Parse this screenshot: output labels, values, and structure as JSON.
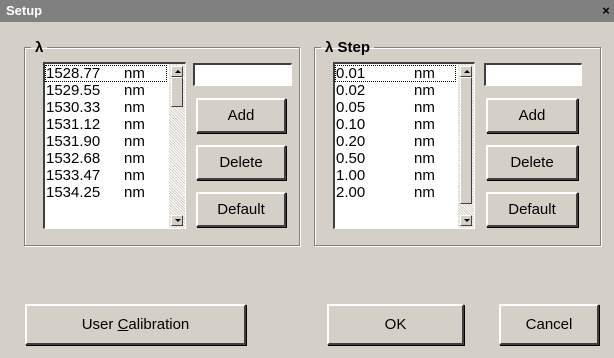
{
  "window": {
    "title": "Setup",
    "close_glyph": "×"
  },
  "lambda_group": {
    "legend": "λ",
    "list": [
      {
        "value": "1528.77",
        "unit": "nm"
      },
      {
        "value": "1529.55",
        "unit": "nm"
      },
      {
        "value": "1530.33",
        "unit": "nm"
      },
      {
        "value": "1531.12",
        "unit": "nm"
      },
      {
        "value": "1531.90",
        "unit": "nm"
      },
      {
        "value": "1532.68",
        "unit": "nm"
      },
      {
        "value": "1533.47",
        "unit": "nm"
      },
      {
        "value": "1534.25",
        "unit": "nm"
      }
    ],
    "input_value": "",
    "add_label": "Add",
    "delete_label": "Delete",
    "default_label": "Default"
  },
  "step_group": {
    "legend": "λ  Step",
    "list": [
      {
        "value": "0.01",
        "unit": "nm"
      },
      {
        "value": "0.02",
        "unit": "nm"
      },
      {
        "value": "0.05",
        "unit": "nm"
      },
      {
        "value": "0.10",
        "unit": "nm"
      },
      {
        "value": "0.20",
        "unit": "nm"
      },
      {
        "value": "0.50",
        "unit": "nm"
      },
      {
        "value": "1.00",
        "unit": "nm"
      },
      {
        "value": "2.00",
        "unit": "nm"
      }
    ],
    "input_value": "",
    "add_label": "Add",
    "delete_label": "Delete",
    "default_label": "Default"
  },
  "footer": {
    "user_calibration_pre": "User ",
    "user_calibration_mnemonic": "C",
    "user_calibration_post": "alibration",
    "ok_label": "OK",
    "cancel_label": "Cancel"
  },
  "colors": {
    "dialog_bg": "#d4d0c8",
    "titlebar_bg": "#808080",
    "titlebar_text": "#ffffff"
  }
}
